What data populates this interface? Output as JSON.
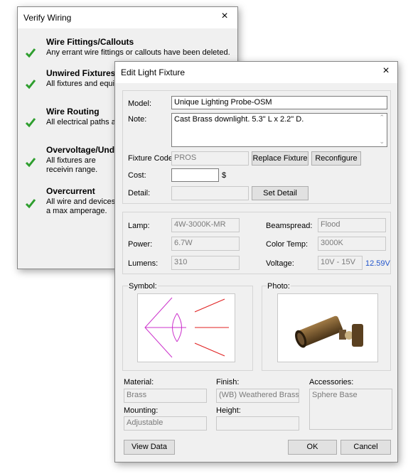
{
  "verify": {
    "title": "Verify Wiring",
    "items": [
      {
        "title": "Wire Fittings/Callouts",
        "desc": "Any errant wire fittings or callouts have been deleted."
      },
      {
        "title": "Unwired Fixtures",
        "desc": "All fixtures and equipm"
      },
      {
        "title": "Wire Routing",
        "desc": "All electrical paths are"
      },
      {
        "title": "Overvoltage/Unde",
        "desc": "All fixtures are receivin range."
      },
      {
        "title": "Overcurrent",
        "desc": "All wire and devices a max amperage."
      }
    ]
  },
  "edit": {
    "title": "Edit Light Fixture",
    "model_label": "Model:",
    "model_value": "Unique Lighting Probe-OSM",
    "note_label": "Note:",
    "note_value": "Cast Brass downlight. 5.3\" L x 2.2\" D.",
    "fixture_code_label": "Fixture Code:",
    "fixture_code_value": "PROS",
    "replace_label": "Replace Fixture",
    "reconfigure_label": "Reconfigure",
    "cost_label": "Cost:",
    "cost_value": "",
    "currency": "$",
    "detail_label": "Detail:",
    "detail_value": "",
    "set_detail_label": "Set Detail",
    "lamp_label": "Lamp:",
    "lamp_value": "4W-3000K-MR",
    "power_label": "Power:",
    "power_value": "6.7W",
    "lumens_label": "Lumens:",
    "lumens_value": "310",
    "beamspread_label": "Beamspread:",
    "beamspread_value": "Flood",
    "color_temp_label": "Color Temp:",
    "color_temp_value": "3000K",
    "voltage_label": "Voltage:",
    "voltage_value": "10V - 15V",
    "voltage_reading": "12.59V",
    "symbol_label": "Symbol:",
    "photo_label": "Photo:",
    "material_label": "Material:",
    "material_value": "Brass",
    "finish_label": "Finish:",
    "finish_value": "(WB) Weathered Brass",
    "accessories_label": "Accessories:",
    "accessories_value": "Sphere Base",
    "mounting_label": "Mounting:",
    "mounting_value": "Adjustable",
    "height_label": "Height:",
    "height_value": "",
    "view_data_label": "View Data",
    "ok_label": "OK",
    "cancel_label": "Cancel"
  },
  "colors": {
    "check": "#2e9e2e",
    "voltage_reading": "#2255cc",
    "symbol_magenta": "#cc33cc",
    "symbol_red": "#e02020"
  },
  "icons": {
    "close": "×",
    "check": "checkmark-icon"
  }
}
